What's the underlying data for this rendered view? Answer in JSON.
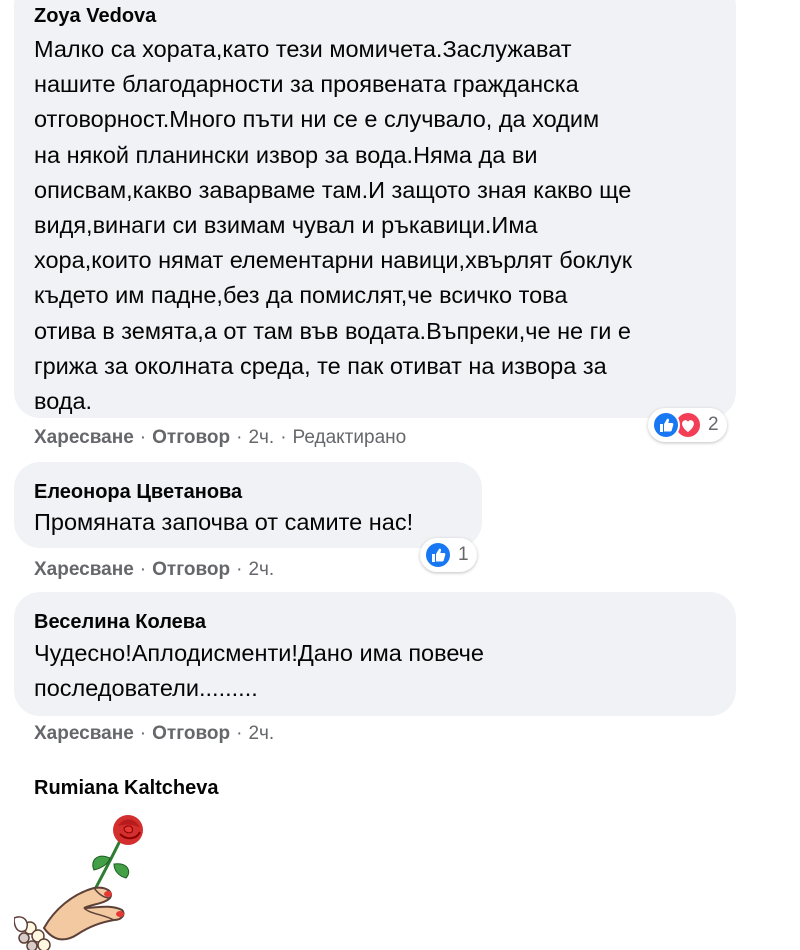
{
  "colors": {
    "bubble": "#f0f2f5",
    "meta_text": "#65676b",
    "like_blue": "#1877f2",
    "love_red": "#f33e58"
  },
  "comments": [
    {
      "author": "Zoya Vedova",
      "text_lines": [
        "Малко са хората,като тези момичета.Заслужават",
        "нашите благодарности за проявената гражданска",
        "отговорност.Много пъти ни се е случвало, да ходим",
        "на някой планински извор за вода.Няма да ви",
        "описвам,какво заварваме там.И защото зная какво ще",
        "видя,винаги си взимам чувал и ръкавици.Има",
        "хора,които нямат елементарни навици,хвърлят боклук",
        "където им падне,без да помислят,че всичко това",
        "отива в земята,а от там във водата.Въпреки,че не ги е",
        "грижа за околната среда, те пак отиват на извора за",
        "вода."
      ],
      "like": "Харесване",
      "reply": "Отговор",
      "time": "2ч.",
      "edited": "Редактирано",
      "reactions": {
        "icons": [
          "like-icon",
          "love-icon"
        ],
        "count": "2"
      }
    },
    {
      "author": "Елеонора Цветанова",
      "text_lines": [
        "Промяната започва от самите нас!"
      ],
      "like": "Харесване",
      "reply": "Отговор",
      "time": "2ч.",
      "reactions": {
        "icons": [
          "like-icon"
        ],
        "count": "1"
      }
    },
    {
      "author": "Веселина Колева",
      "text_lines": [
        "Чудесно!Аплодисменти!Дано има повече",
        "последователи........."
      ],
      "like": "Харесване",
      "reply": "Отговор",
      "time": "2ч."
    },
    {
      "author": "Rumiana Kaltcheva",
      "sticker": "hand-holding-rose-sticker"
    }
  ],
  "separator": "·"
}
